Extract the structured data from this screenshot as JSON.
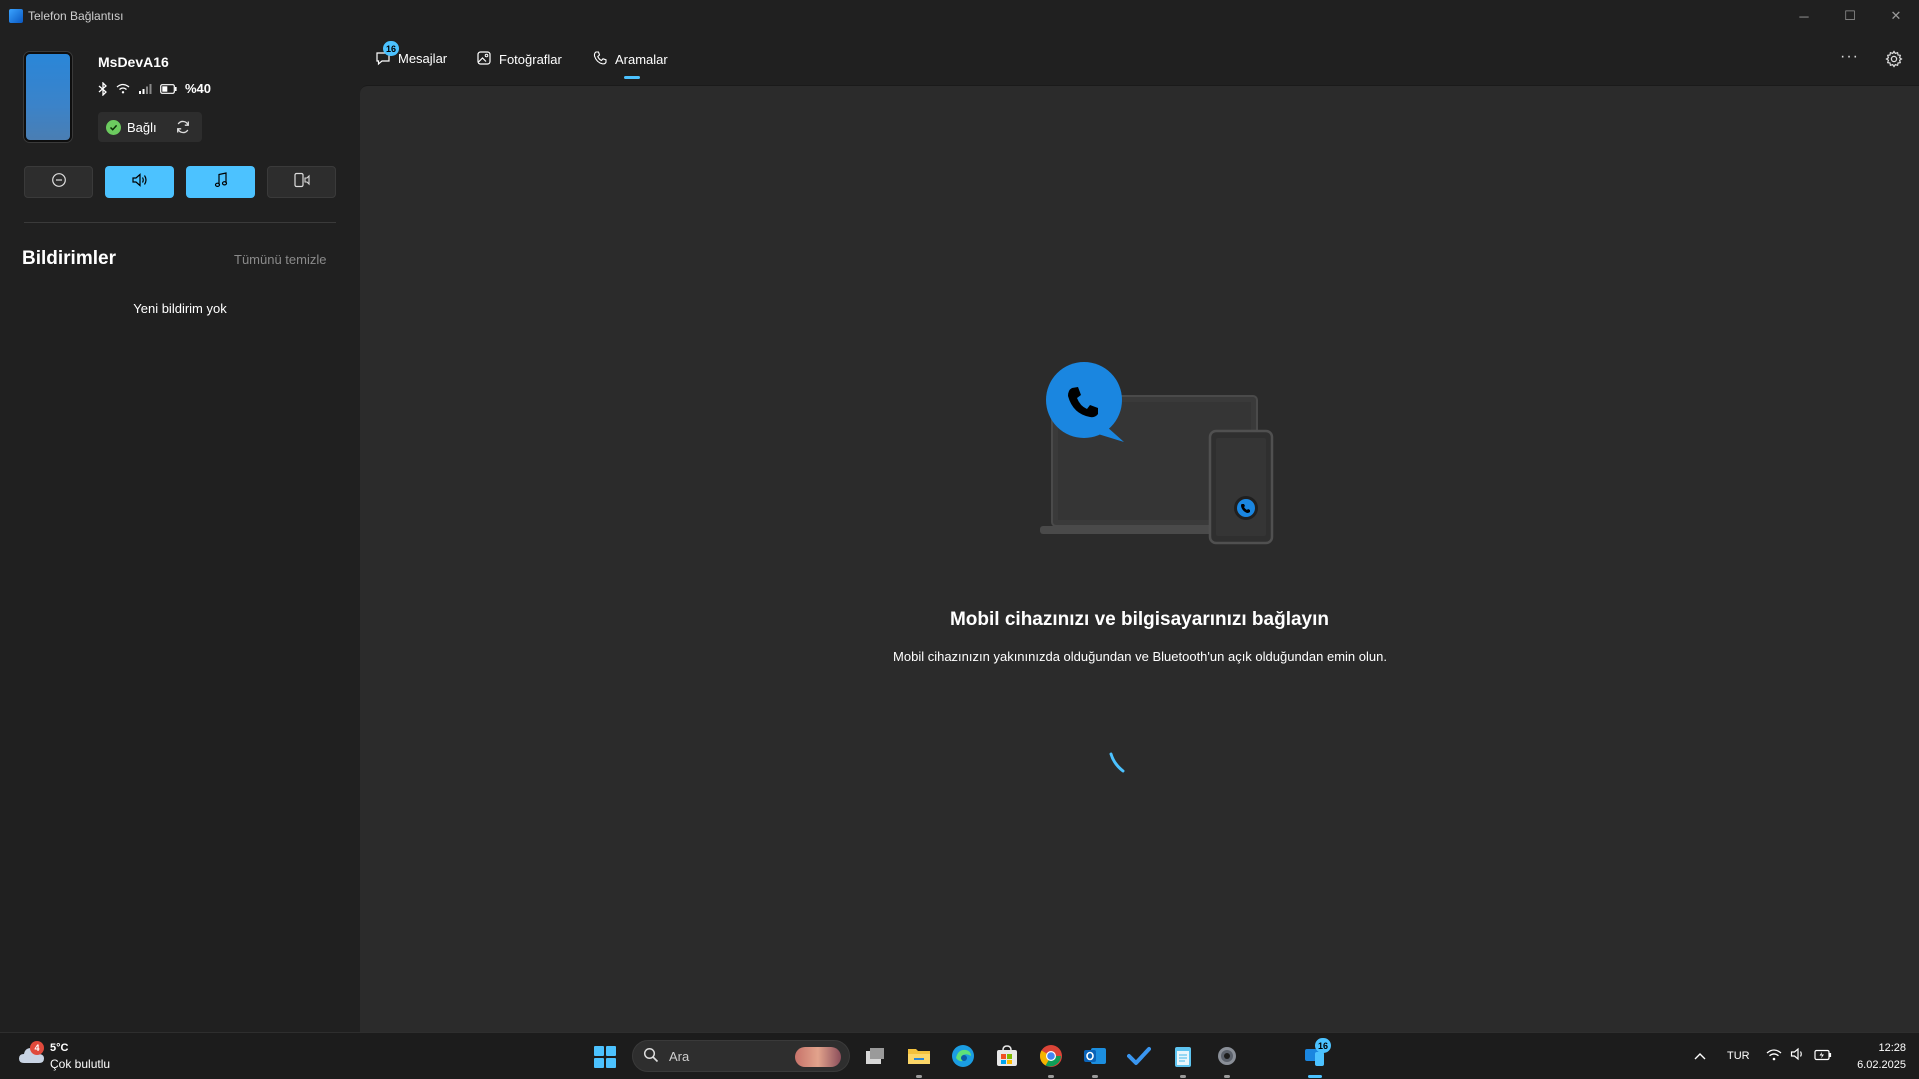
{
  "app": {
    "title": "Telefon Bağlantısı",
    "window_controls": {
      "minimize": "─",
      "maximize": "☐",
      "close": "✕"
    }
  },
  "device": {
    "name": "MsDevA16",
    "battery": "%40",
    "connection_status": "Bağlı",
    "status_icons": [
      "bluetooth-icon",
      "wifi-icon",
      "signal-icon",
      "battery-icon"
    ]
  },
  "quick_actions": [
    {
      "name": "do-not-disturb",
      "active": false
    },
    {
      "name": "volume",
      "active": true
    },
    {
      "name": "media",
      "active": true
    },
    {
      "name": "audio-output",
      "active": false
    }
  ],
  "notifications": {
    "title": "Bildirimler",
    "clear_all": "Tümünü temizle",
    "empty": "Yeni bildirim yok"
  },
  "tabs": [
    {
      "label": "Mesajlar",
      "badge": "16",
      "icon": "messages-icon"
    },
    {
      "label": "Fotoğraflar",
      "icon": "photos-icon"
    },
    {
      "label": "Aramalar",
      "icon": "calls-icon",
      "selected": true
    }
  ],
  "main": {
    "title": "Mobil cihazınızı ve bilgisayarınızı bağlayın",
    "description": "Mobil cihazınızın yakınınızda olduğundan ve Bluetooth'un açık olduğundan emin olun."
  },
  "taskbar": {
    "weather": {
      "badge": "4",
      "temp": "5°C",
      "condition": "Çok bulutlu"
    },
    "search_placeholder": "Ara",
    "phone_link_badge": "16",
    "language": "TUR",
    "time": "12:28",
    "date": "6.02.2025",
    "apps": [
      "task-view",
      "file-explorer",
      "edge",
      "store",
      "chrome",
      "outlook",
      "todo",
      "notepad",
      "settings",
      "phone-link"
    ]
  },
  "colors": {
    "accent": "#4cc2ff",
    "window_bg": "#202020",
    "panel_bg": "#2b2b2b",
    "connected": "#6ccb5f"
  }
}
